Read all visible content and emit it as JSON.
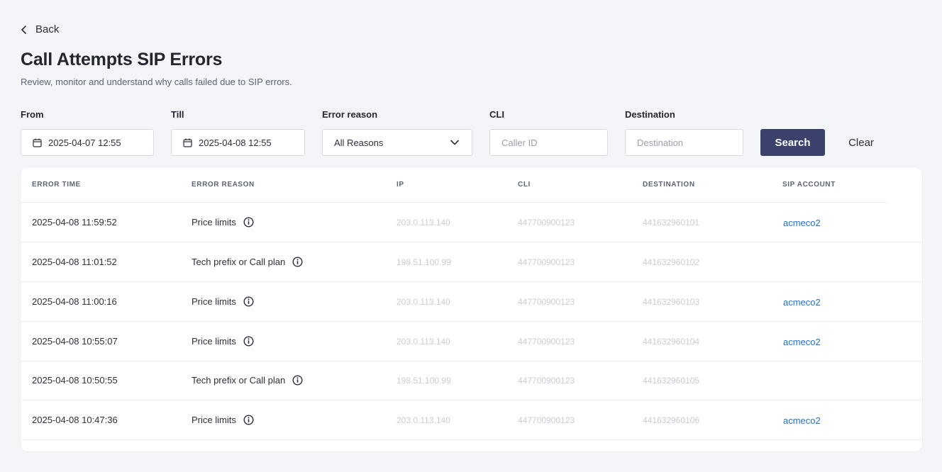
{
  "back_label": "Back",
  "title": "Call Attempts SIP Errors",
  "subtitle": "Review, monitor and understand why calls failed due to SIP errors.",
  "filters": {
    "from_label": "From",
    "from_value": "2025-04-07 12:55",
    "till_label": "Till",
    "till_value": "2025-04-08 12:55",
    "reason_label": "Error reason",
    "reason_value": "All Reasons",
    "cli_label": "CLI",
    "cli_placeholder": "Caller ID",
    "destination_label": "Destination",
    "destination_placeholder": "Destination",
    "search_label": "Search",
    "clear_label": "Clear"
  },
  "table": {
    "headers": [
      "ERROR TIME",
      "ERROR REASON",
      "IP",
      "CLI",
      "DESTINATION",
      "SIP ACCOUNT"
    ],
    "rows": [
      {
        "time": "2025-04-08 11:59:52",
        "reason": "Price limits",
        "ip": "203.0.113.140",
        "cli": "447700900123",
        "destination": "441632960101",
        "account": "acmeco2"
      },
      {
        "time": "2025-04-08 11:01:52",
        "reason": "Tech prefix or Call plan",
        "ip": "198.51.100.99",
        "cli": "447700900123",
        "destination": "441632960102",
        "account": ""
      },
      {
        "time": "2025-04-08 11:00:16",
        "reason": "Price limits",
        "ip": "203.0.113.140",
        "cli": "447700900123",
        "destination": "441632960103",
        "account": "acmeco2"
      },
      {
        "time": "2025-04-08 10:55:07",
        "reason": "Price limits",
        "ip": "203.0.113.140",
        "cli": "447700900123",
        "destination": "441632960104",
        "account": "acmeco2"
      },
      {
        "time": "2025-04-08 10:50:55",
        "reason": "Tech prefix or Call plan",
        "ip": "198.51.100.99",
        "cli": "447700900123",
        "destination": "441632960105",
        "account": ""
      },
      {
        "time": "2025-04-08 10:47:36",
        "reason": "Price limits",
        "ip": "203.0.113.140",
        "cli": "447700900123",
        "destination": "441632960106",
        "account": "acmeco2"
      }
    ]
  },
  "icons": {
    "back": "chevron-left-icon",
    "calendar": "calendar-icon",
    "dropdown": "chevron-down-icon",
    "info": "info-circle-icon"
  },
  "colors": {
    "primary_button": "#3a416a",
    "link": "#1f6fd1",
    "background": "#f4f5f9"
  }
}
